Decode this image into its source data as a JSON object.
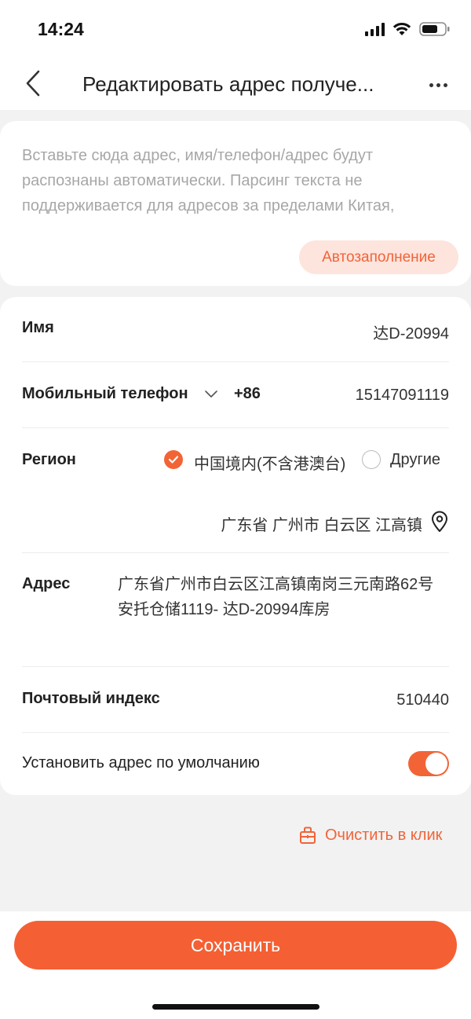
{
  "status_bar": {
    "time": "14:24",
    "icons": [
      "cellular-signal-icon",
      "wifi-icon",
      "battery-icon"
    ]
  },
  "nav": {
    "title": "Редактировать адрес получе...",
    "back_icon": "chevron-left-icon",
    "more_icon": "more-dots-icon"
  },
  "paste": {
    "placeholder": "Вставьте сюда адрес, имя/телефон/адрес будут распознаны автоматически. Парсинг текста не поддерживается для адресов за пределами Китая,",
    "autofill_label": "Автозаполнение"
  },
  "form": {
    "name": {
      "label": "Имя",
      "value": "达D-20994"
    },
    "phone": {
      "label": "Мобильный телефон",
      "code": "+86",
      "value": "15147091119"
    },
    "region": {
      "label": "Регион",
      "options": [
        {
          "label": "中国境内(不含港澳台)",
          "selected": true
        },
        {
          "label": "Другие",
          "selected": false
        }
      ],
      "location": "广东省 广州市 白云区 江高镇"
    },
    "address": {
      "label": "Адрес",
      "value": "广东省广州市白云区江高镇南岗三元南路62号安托仓储1119- 达D-20994库房"
    },
    "postal": {
      "label": "Почтовый индекс",
      "value": "510440"
    },
    "default_address": {
      "label": "Установить адрес по умолчанию",
      "enabled": true
    }
  },
  "clear": {
    "label": "Очистить в клик",
    "icon": "eraser-icon"
  },
  "save": {
    "label": "Сохранить"
  },
  "colors": {
    "accent": "#f26435",
    "accent_light": "#fde4dc",
    "background": "#f2f2f2",
    "placeholder": "#a7a7a7"
  }
}
